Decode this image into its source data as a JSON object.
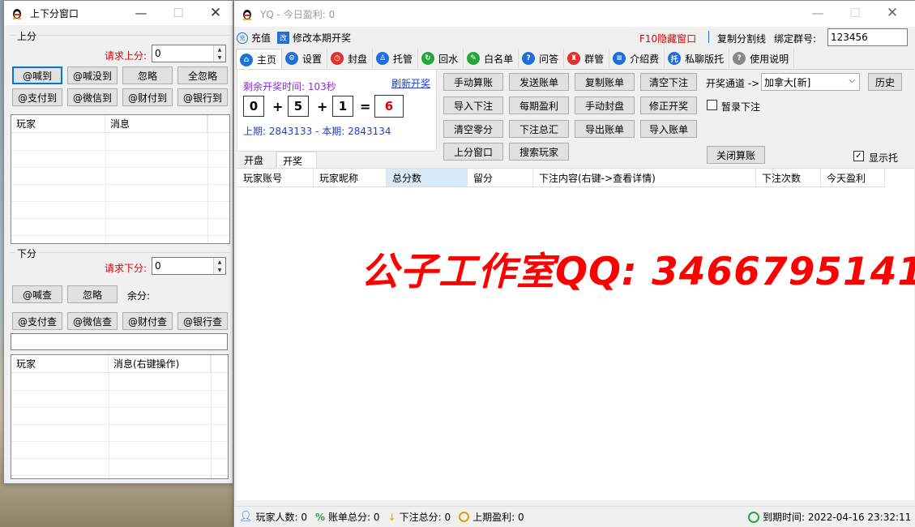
{
  "left_window": {
    "title": "上下分窗口",
    "up_group": "上分",
    "request_up_label": "请求上分:",
    "request_up_value": "0",
    "buttons_row1": [
      "@喊到",
      "@喊没到",
      "忽略",
      "全忽略"
    ],
    "buttons_row2": [
      "@支付到",
      "@微信到",
      "@财付到",
      "@银行到"
    ],
    "grid1_headers": [
      "玩家",
      "消息"
    ],
    "down_group": "下分",
    "request_down_label": "请求下分:",
    "request_down_value": "0",
    "down_buttons_row1": [
      "@喊查",
      "忽略"
    ],
    "balance_label": "余分:",
    "down_buttons_row2": [
      "@支付查",
      "@微信查",
      "@财付查",
      "@银行查"
    ],
    "grid2_headers": [
      "玩家",
      "消息(右键操作)"
    ]
  },
  "main_window": {
    "title": "YQ - 今日盈利: 0",
    "toolbar": {
      "recharge": "充值",
      "modify": "修改本期开奖",
      "hide": "F10隐藏窗口",
      "copy_split": "复制分割线",
      "bind_group_label": "绑定群号:",
      "bind_group_value": "123456"
    },
    "tabs": [
      {
        "label": "主页",
        "icon": "home-icon",
        "color": "#1e6fd9"
      },
      {
        "label": "设置",
        "icon": "gear-icon",
        "color": "#1e6fd9"
      },
      {
        "label": "封盘",
        "icon": "clock-icon",
        "color": "#e03030"
      },
      {
        "label": "托管",
        "icon": "user-icon",
        "color": "#1e6fd9"
      },
      {
        "label": "回水",
        "icon": "refresh-icon",
        "color": "#22a83a"
      },
      {
        "label": "白名单",
        "icon": "tag-icon",
        "color": "#22a83a"
      },
      {
        "label": "问答",
        "icon": "question-icon",
        "color": "#1e6fd9"
      },
      {
        "label": "群管",
        "icon": "group-icon",
        "color": "#e03030"
      },
      {
        "label": "介绍费",
        "icon": "doc-icon",
        "color": "#1e6fd9"
      },
      {
        "label": "私聊版托",
        "icon": "chat-icon",
        "color": "#1e6fd9"
      },
      {
        "label": "使用说明",
        "icon": "help-icon",
        "color": "#888888"
      }
    ],
    "lottery": {
      "countdown": "剩余开奖时间: 103秒",
      "refresh": "刷新开奖",
      "n1": "0",
      "plus1": "+",
      "n2": "5",
      "plus2": "+",
      "n3": "1",
      "eq": "=",
      "result": "6",
      "periods": "上期: 2843133 - 本期: 2843134"
    },
    "action_buttons": [
      [
        "手动算账",
        "发送账单",
        "复制账单",
        "清空下注"
      ],
      [
        "导入下注",
        "每期盈利",
        "手动封盘",
        "修正开奖"
      ],
      [
        "清空零分",
        "下注总汇",
        "导出账单",
        "导入账单"
      ],
      [
        "上分窗口",
        "搜索玩家"
      ]
    ],
    "channel_label": "开奖通道 ->",
    "channel_value": "加拿大[新]",
    "history": "历史",
    "pause_bet": "暂录下注",
    "close_calc": "关闭算账",
    "show_bots": "显示托",
    "subtabs": [
      "开盘",
      "开奖"
    ],
    "grid_headers": [
      "玩家账号",
      "玩家昵称",
      "总分数",
      "留分",
      "下注内容(右键->查看详情)",
      "下注次数",
      "今天盈利"
    ],
    "watermark": "公子工作室QQ: 3466795141",
    "status": {
      "players": "玩家人数: 0",
      "bill_total": "账单总分: 0",
      "bet_total": "下注总分: 0",
      "last_profit": "上期盈利: 0",
      "expire": "到期时间: 2022-04-16 23:32:11"
    }
  }
}
